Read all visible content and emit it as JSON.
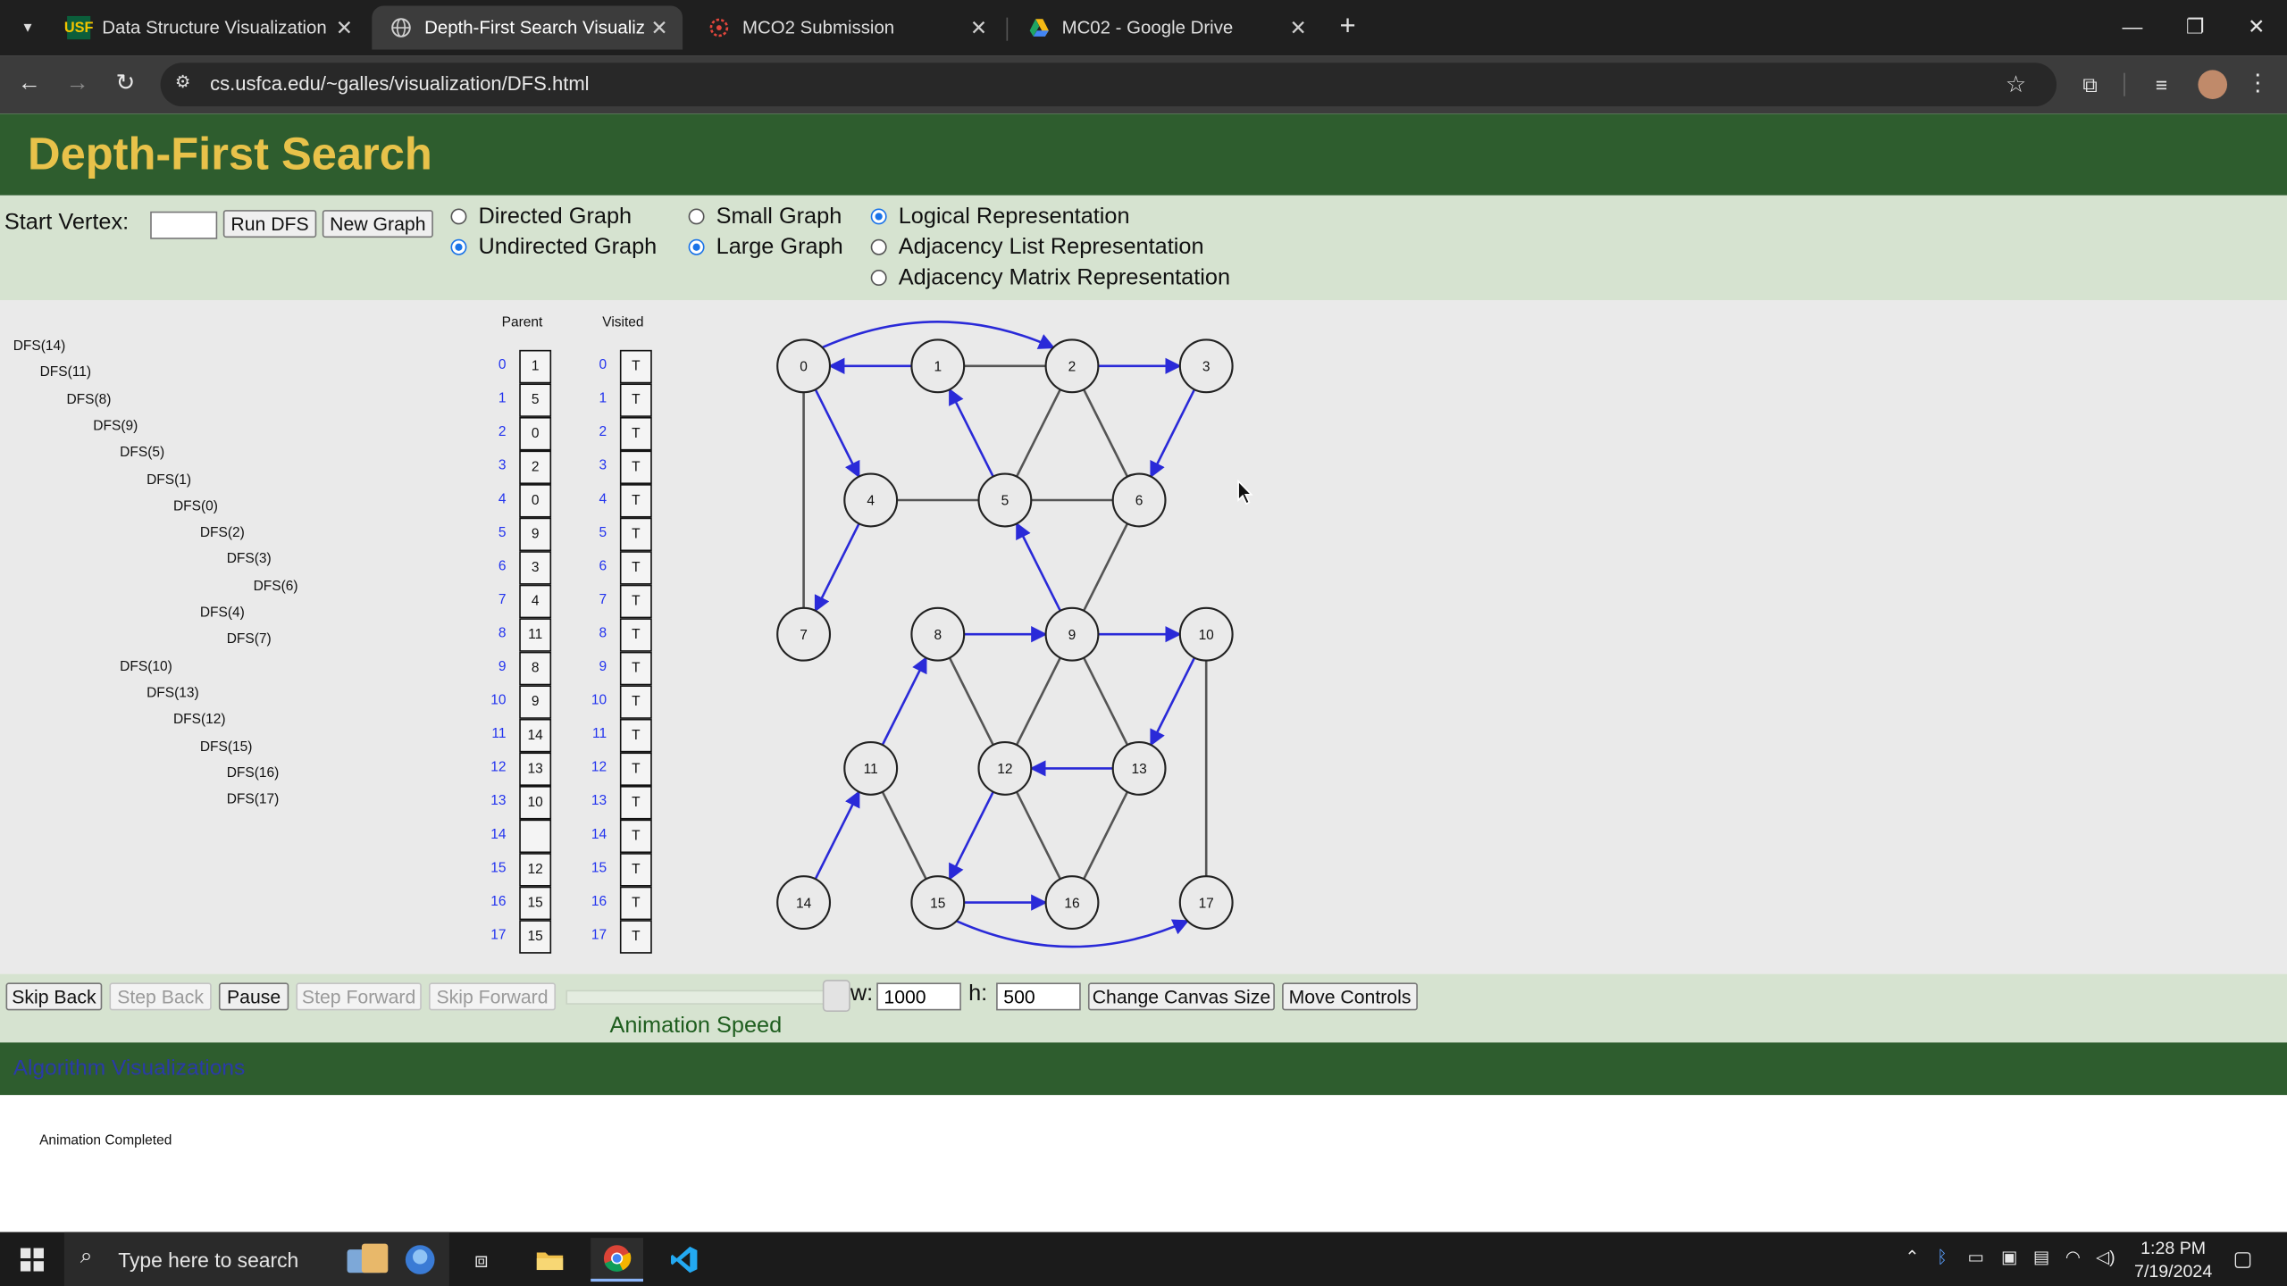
{
  "browser": {
    "tabs": [
      {
        "title": "Data Structure Visualization",
        "favicon": "USF",
        "active": false
      },
      {
        "title": "Depth-First Search Visualization",
        "favicon": "globe-icon",
        "active": true
      },
      {
        "title": "MCO2 Submission",
        "favicon": "canvas-icon",
        "active": false
      },
      {
        "title": "MC02 - Google Drive",
        "favicon": "drive-icon",
        "active": false
      }
    ],
    "url": "cs.usfca.edu/~galles/visualization/DFS.html"
  },
  "page": {
    "title": "Depth-First Search",
    "controls": {
      "start_vertex_label": "Start Vertex:",
      "start_vertex_value": "",
      "run_dfs": "Run DFS",
      "new_graph": "New Graph",
      "directed": "Directed Graph",
      "undirected": "Undirected Graph",
      "small": "Small Graph",
      "large": "Large Graph",
      "logical": "Logical Representation",
      "adj_list": "Adjacency List Representation",
      "adj_matrix": "Adjacency Matrix Representation",
      "selected": {
        "direction": "Undirected Graph",
        "size": "Large Graph",
        "representation": "Logical Representation"
      }
    },
    "trace": [
      "DFS(14)",
      "DFS(11)",
      "DFS(8)",
      "DFS(9)",
      "DFS(5)",
      "DFS(1)",
      "DFS(0)",
      "DFS(2)",
      "DFS(3)",
      "DFS(6)",
      "DFS(4)",
      "DFS(7)",
      "DFS(10)",
      "DFS(13)",
      "DFS(12)",
      "DFS(15)",
      "DFS(16)",
      "DFS(17)"
    ],
    "trace_depth": [
      0,
      1,
      2,
      3,
      4,
      5,
      6,
      7,
      8,
      9,
      7,
      8,
      4,
      5,
      6,
      7,
      8,
      8
    ],
    "table": {
      "parent_header": "Parent",
      "visited_header": "Visited",
      "indices": [
        "0",
        "1",
        "2",
        "3",
        "4",
        "5",
        "6",
        "7",
        "8",
        "9",
        "10",
        "11",
        "12",
        "13",
        "14",
        "15",
        "16",
        "17"
      ],
      "parent": [
        "1",
        "5",
        "0",
        "2",
        "0",
        "9",
        "3",
        "4",
        "11",
        "8",
        "9",
        "14",
        "13",
        "10",
        "",
        "12",
        "15",
        "15"
      ],
      "visited": [
        "T",
        "T",
        "T",
        "T",
        "T",
        "T",
        "T",
        "T",
        "T",
        "T",
        "T",
        "T",
        "T",
        "T",
        "T",
        "T",
        "T",
        "T"
      ]
    },
    "graph": {
      "nodes": [
        {
          "id": "0",
          "col": 0,
          "row": 0
        },
        {
          "id": "1",
          "col": 1,
          "row": 0
        },
        {
          "id": "2",
          "col": 2,
          "row": 0
        },
        {
          "id": "3",
          "col": 3,
          "row": 0
        },
        {
          "id": "4",
          "col": 0.5,
          "row": 1
        },
        {
          "id": "5",
          "col": 1.5,
          "row": 1
        },
        {
          "id": "6",
          "col": 2.5,
          "row": 1
        },
        {
          "id": "7",
          "col": 0,
          "row": 2
        },
        {
          "id": "8",
          "col": 1,
          "row": 2
        },
        {
          "id": "9",
          "col": 2,
          "row": 2
        },
        {
          "id": "10",
          "col": 3,
          "row": 2
        },
        {
          "id": "11",
          "col": 0.5,
          "row": 3
        },
        {
          "id": "12",
          "col": 1.5,
          "row": 3
        },
        {
          "id": "13",
          "col": 2.5,
          "row": 3
        },
        {
          "id": "14",
          "col": 0,
          "row": 4
        },
        {
          "id": "15",
          "col": 1,
          "row": 4
        },
        {
          "id": "16",
          "col": 2,
          "row": 4
        },
        {
          "id": "17",
          "col": 3,
          "row": 4
        }
      ],
      "tree_edges": [
        [
          "1",
          "0"
        ],
        [
          "0",
          "2"
        ],
        [
          "2",
          "3"
        ],
        [
          "3",
          "6"
        ],
        [
          "0",
          "4"
        ],
        [
          "4",
          "7"
        ],
        [
          "5",
          "1"
        ],
        [
          "9",
          "5"
        ],
        [
          "8",
          "9"
        ],
        [
          "9",
          "10"
        ],
        [
          "10",
          "13"
        ],
        [
          "13",
          "12"
        ],
        [
          "12",
          "15"
        ],
        [
          "15",
          "16"
        ],
        [
          "15",
          "17"
        ],
        [
          "11",
          "8"
        ],
        [
          "14",
          "11"
        ]
      ],
      "curved_tree_edges": [
        [
          "0",
          "2"
        ],
        [
          "15",
          "17"
        ]
      ],
      "other_edges": [
        [
          "1",
          "2"
        ],
        [
          "0",
          "7"
        ],
        [
          "4",
          "5"
        ],
        [
          "5",
          "6"
        ],
        [
          "2",
          "5"
        ],
        [
          "2",
          "6"
        ],
        [
          "6",
          "9"
        ],
        [
          "8",
          "12"
        ],
        [
          "9",
          "12"
        ],
        [
          "9",
          "13"
        ],
        [
          "11",
          "15"
        ],
        [
          "12",
          "16"
        ],
        [
          "13",
          "16"
        ],
        [
          "10",
          "17"
        ]
      ]
    },
    "animation_status": "Animation Completed",
    "bottom": {
      "skip_back": "Skip Back",
      "step_back": "Step Back",
      "pause": "Pause",
      "step_forward": "Step Forward",
      "skip_forward": "Skip Forward",
      "w_label": "w:",
      "w_value": "1000",
      "h_label": "h:",
      "h_value": "500",
      "change_canvas": "Change Canvas Size",
      "move_controls": "Move Controls",
      "speed_label": "Animation Speed"
    },
    "footer_link": "Algorithm Visualizations"
  },
  "taskbar": {
    "search_placeholder": "Type here to search",
    "time": "1:28 PM",
    "date": "7/19/2024"
  },
  "colors": {
    "header_bg": "#2e5d2e",
    "title": "#e8c24a",
    "controls_bg": "#d6e3d0",
    "tree_edge": "#2a2ad8",
    "index_blue": "#2233ee"
  }
}
